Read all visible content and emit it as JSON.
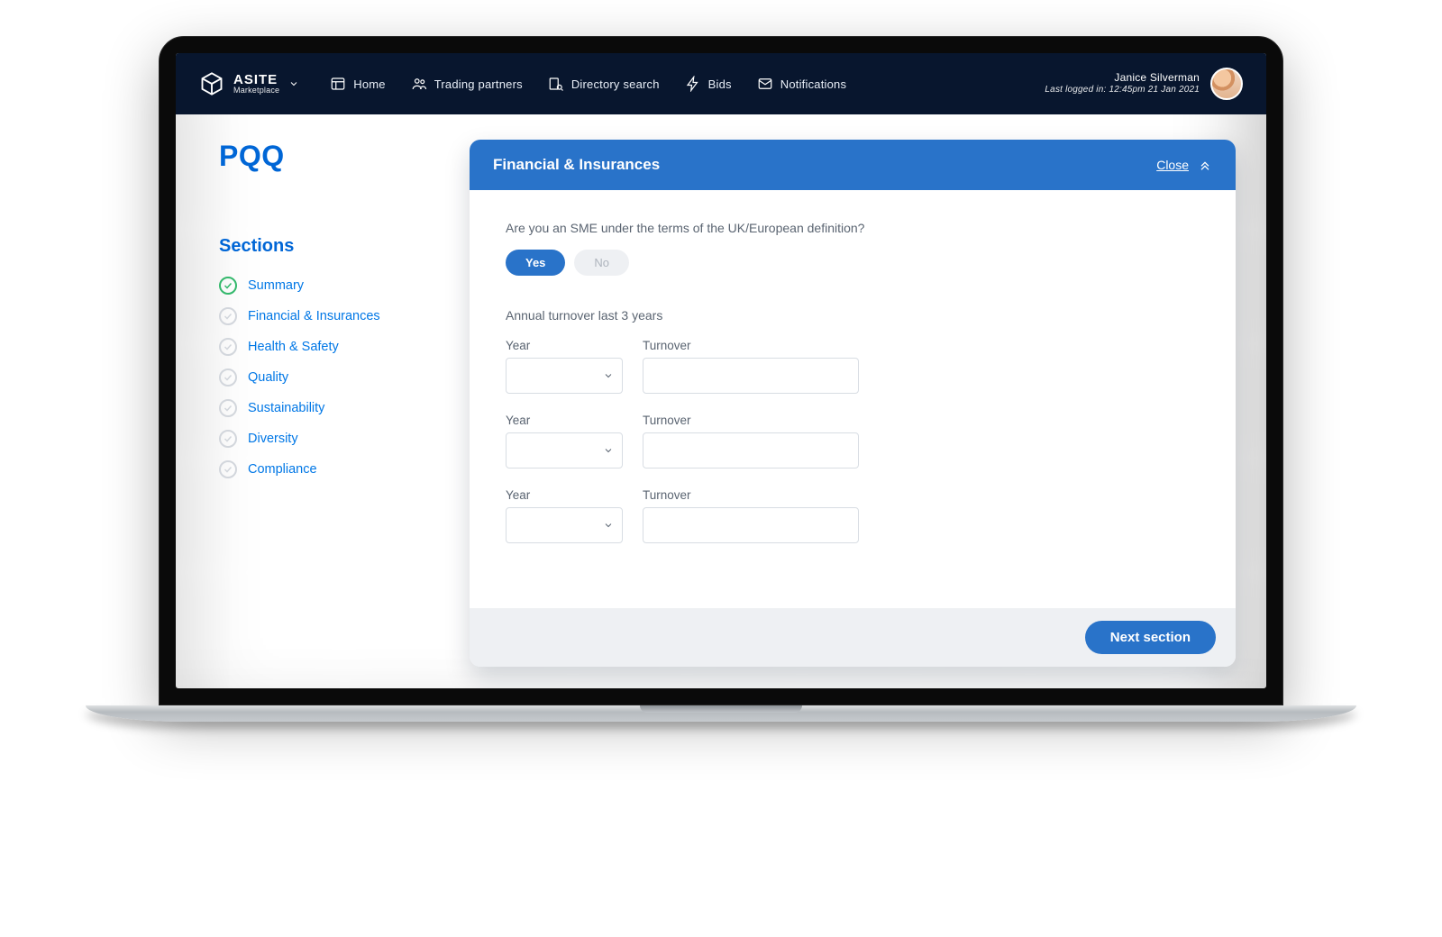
{
  "brand": {
    "name": "ASITE",
    "sub": "Marketplace"
  },
  "nav": {
    "home": "Home",
    "partners": "Trading partners",
    "directory": "Directory search",
    "bids": "Bids",
    "notifications": "Notifications"
  },
  "user": {
    "name": "Janice Silverman",
    "last_login": "Last logged in: 12:45pm 21 Jan 2021"
  },
  "page": {
    "title": "PQQ",
    "sections_heading": "Sections"
  },
  "sections": [
    {
      "label": "Summary",
      "done": true
    },
    {
      "label": "Financial & Insurances",
      "done": false
    },
    {
      "label": "Health & Safety",
      "done": false
    },
    {
      "label": "Quality",
      "done": false
    },
    {
      "label": "Sustainability",
      "done": false
    },
    {
      "label": "Diversity",
      "done": false
    },
    {
      "label": "Compliance",
      "done": false
    }
  ],
  "panel": {
    "title": "Financial & Insurances",
    "close": "Close",
    "q1": "Are you an SME under the terms of the UK/European definition?",
    "yes": "Yes",
    "no": "No",
    "subheading": "Annual turnover last 3 years",
    "year_label": "Year",
    "turnover_label": "Turnover",
    "next": "Next section"
  }
}
